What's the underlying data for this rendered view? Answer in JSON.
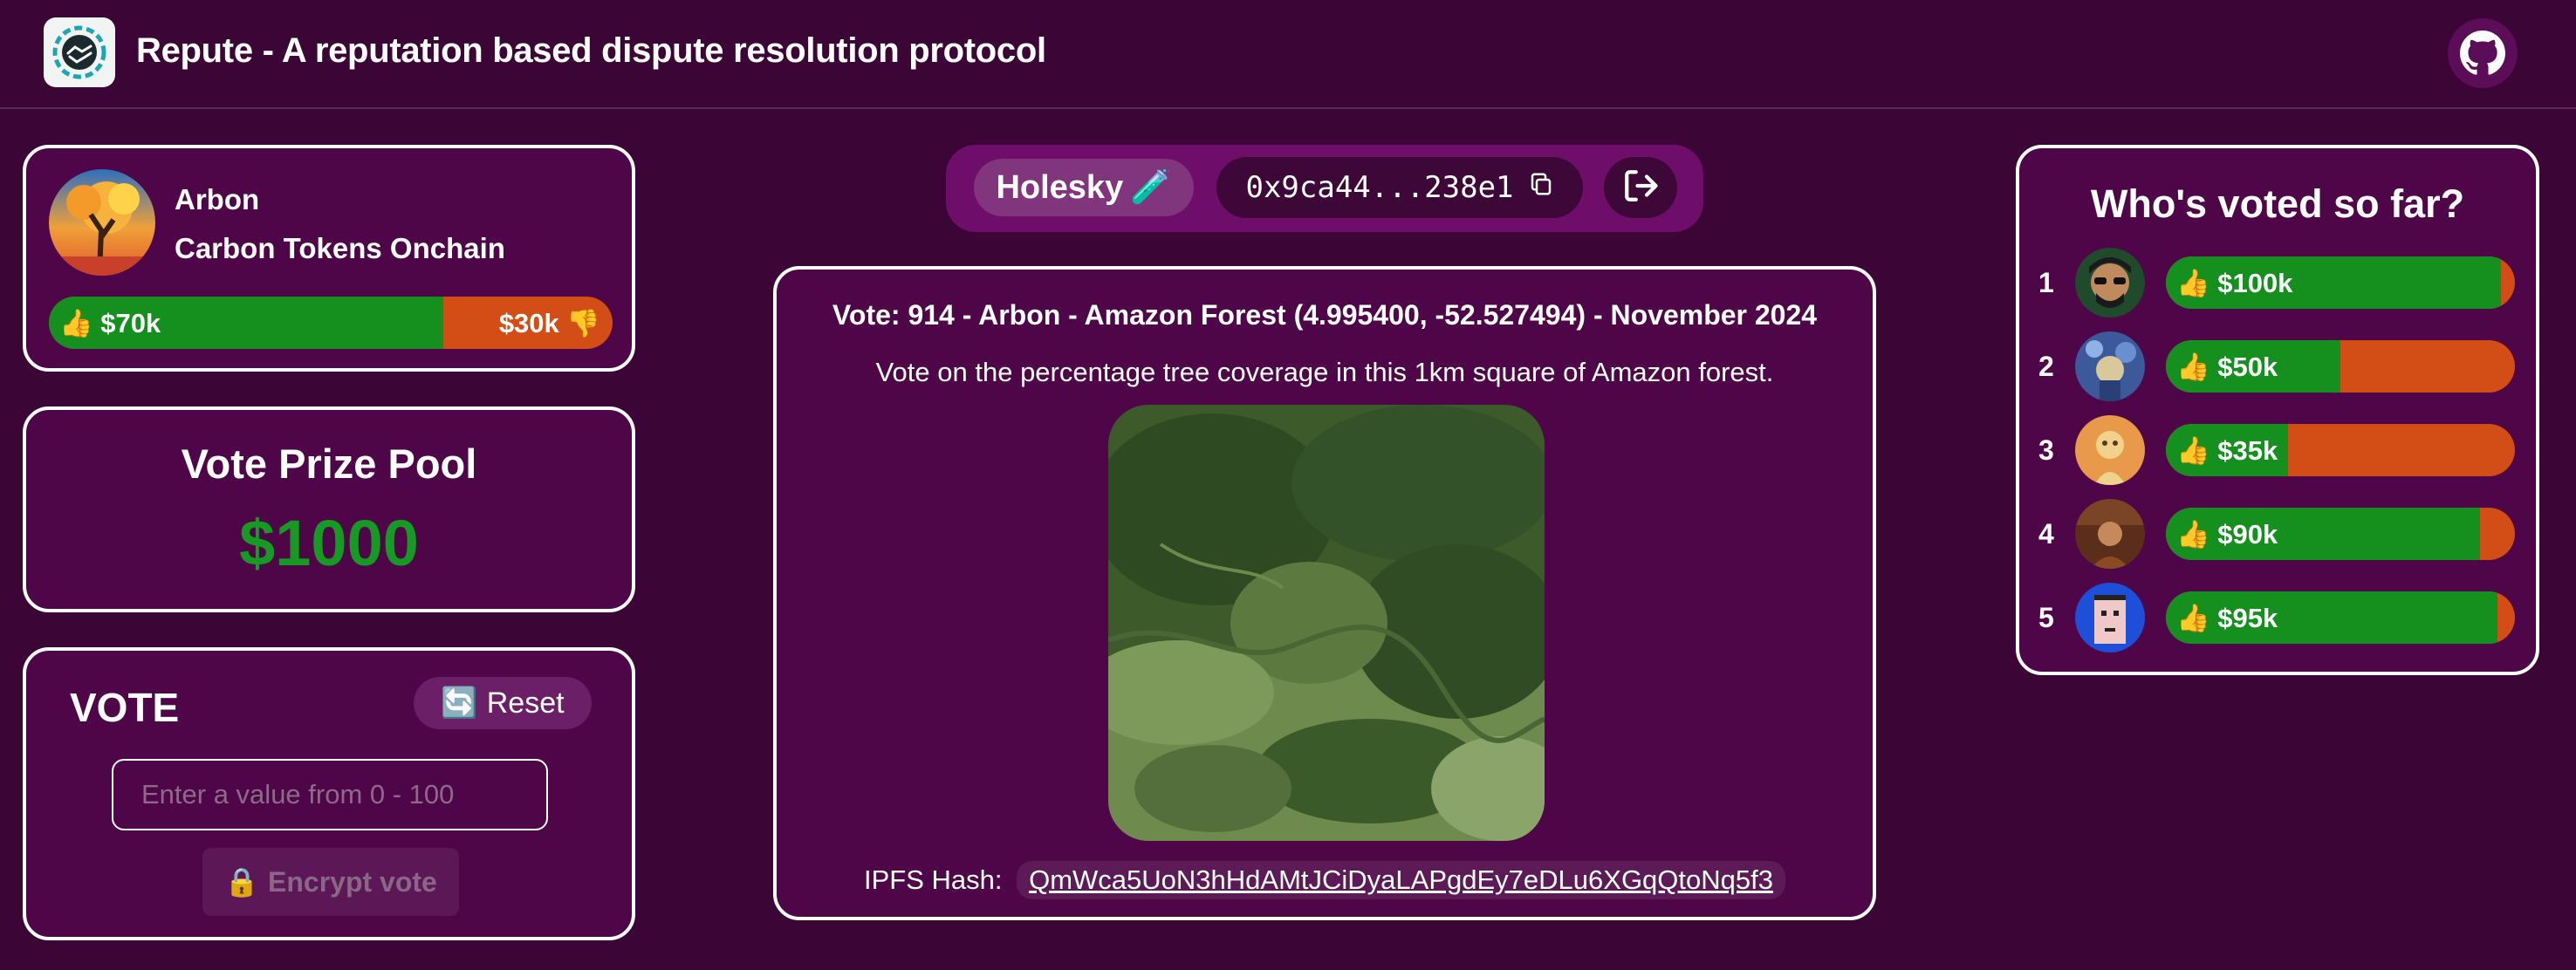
{
  "header": {
    "title": "Repute - A reputation based dispute resolution protocol",
    "logo_icon": "handshake-logo-icon",
    "github_icon": "github-icon"
  },
  "project": {
    "name": "Arbon",
    "subtitle": "Carbon Tokens Onchain",
    "yes_label": "👍 $70k",
    "no_label": "$30k 👎",
    "yes_fraction": 0.7
  },
  "prize_pool": {
    "title": "Vote Prize Pool",
    "value": "$1000"
  },
  "vote": {
    "title": "VOTE",
    "reset_label": "Reset",
    "reset_icon": "🔄",
    "input_placeholder": "Enter a value from 0 - 100",
    "encrypt_label": "Encrypt vote",
    "encrypt_icon": "🔒"
  },
  "network": {
    "name": "Holesky",
    "name_icon": "🧪",
    "address": "0x9ca44...238e1",
    "copy_icon": "copy-icon",
    "logout_icon": "logout-icon"
  },
  "main": {
    "heading": "Vote: 914 - Arbon - Amazon Forest (4.995400, -52.527494) - November 2024",
    "description": "Vote on the percentage tree coverage in this 1km square of Amazon forest.",
    "ipfs_label": "IPFS Hash:",
    "ipfs_hash": "QmWca5UoN3hHdAMtJCiDyaLAPgdEy7eDLu6XGqQtoNq5f3"
  },
  "leaderboard": {
    "title": "Who's voted so far?",
    "rows": [
      {
        "rank": "1",
        "label": "👍 $100k",
        "yes_fraction": 0.96
      },
      {
        "rank": "2",
        "label": "👍 $50k",
        "yes_fraction": 0.5
      },
      {
        "rank": "3",
        "label": "👍 $35k",
        "yes_fraction": 0.35
      },
      {
        "rank": "4",
        "label": "👍 $90k",
        "yes_fraction": 0.9
      },
      {
        "rank": "5",
        "label": "👍 $95k",
        "yes_fraction": 0.95
      }
    ]
  },
  "colors": {
    "background": "#3b0536",
    "card": "#4e0648",
    "yes": "#15901f",
    "no": "#d24e16",
    "prize": "#179a24"
  }
}
